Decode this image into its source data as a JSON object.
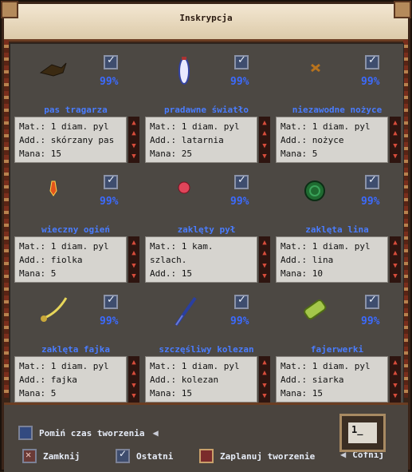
{
  "window": {
    "title": "Inskrypcja"
  },
  "items": [
    {
      "name": "pas tragarza",
      "pct": "99%",
      "mat": "Mat.: 1 diam. pyl",
      "add": "Add.: skórzany pas",
      "mana": "Mana: 15",
      "icon": "belt-icon"
    },
    {
      "name": "pradawne światło",
      "pct": "99%",
      "mat": "Mat.: 1 diam. pyl",
      "add": "Add.: latarnia",
      "mana": "Mana: 25",
      "icon": "lantern-icon"
    },
    {
      "name": "niezawodne nożyce",
      "pct": "99%",
      "mat": "Mat.: 1 diam. pyl",
      "add": "Add.: nożyce",
      "mana": "Mana: 5",
      "icon": "scissors-icon"
    },
    {
      "name": "wieczny ogień",
      "pct": "99%",
      "mat": "Mat.: 1 diam. pyl",
      "add": "Add.: fiolka",
      "mana": "Mana: 5",
      "icon": "flame-vial-icon"
    },
    {
      "name": "zaklęty pył",
      "pct": "99%",
      "mat": "Mat.: 1 kam. szlach.",
      "add": "Add.: 15",
      "mana": "",
      "icon": "red-dust-icon"
    },
    {
      "name": "zaklęta lina",
      "pct": "99%",
      "mat": "Mat.: 1 diam. pyl",
      "add": "Add.: lina",
      "mana": "Mana: 10",
      "icon": "rope-icon"
    },
    {
      "name": "zaklęta fajka",
      "pct": "99%",
      "mat": "Mat.: 1 diam. pyl",
      "add": "Add.: fajka",
      "mana": "Mana: 5",
      "icon": "pipe-icon"
    },
    {
      "name": "szczęśliwy kolezan",
      "pct": "99%",
      "mat": "Mat.: 1 diam. pyl",
      "add": "Add.: kolezan",
      "mana": "Mana: 15",
      "icon": "dagger-icon"
    },
    {
      "name": "fajerwerki",
      "pct": "99%",
      "mat": "Mat.: 1 diam. pyl",
      "add": "Add.: siarka",
      "mana": "Mana: 15",
      "icon": "firework-icon"
    }
  ],
  "footer": {
    "skip_label": "Pomiń czas tworzenia",
    "close_label": "Zamknij",
    "last_label": "Ostatni",
    "plan_label": "Zaplanuj tworzenie",
    "back_label": "Cofnij",
    "count_value": "1_"
  }
}
